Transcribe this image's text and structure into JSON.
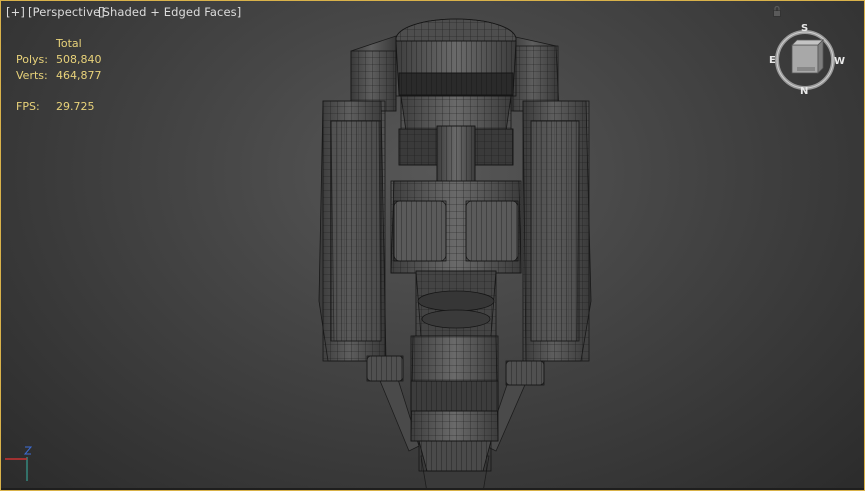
{
  "viewport": {
    "labels": {
      "plus": "[+]",
      "perspective": "[Perspective]",
      "shading": "[Shaded + Edged Faces]"
    },
    "stats": {
      "total_label": "Total",
      "polys_label": "Polys:",
      "polys_value": "508,840",
      "verts_label": "Verts:",
      "verts_value": "464,877",
      "fps_label": "FPS:",
      "fps_value": "29.725"
    },
    "viewcube": {
      "south": "S",
      "east": "E",
      "west": "W",
      "north": "N"
    },
    "colors": {
      "border": "#d9b24a",
      "stats_text": "#e8d27a",
      "axis_x": "#c83232",
      "axis_y": "#2fa02f",
      "axis_z": "#3c6cd6"
    },
    "icons": [
      "lock-icon",
      "viewcube-icon",
      "axis-gizmo-icon"
    ]
  }
}
